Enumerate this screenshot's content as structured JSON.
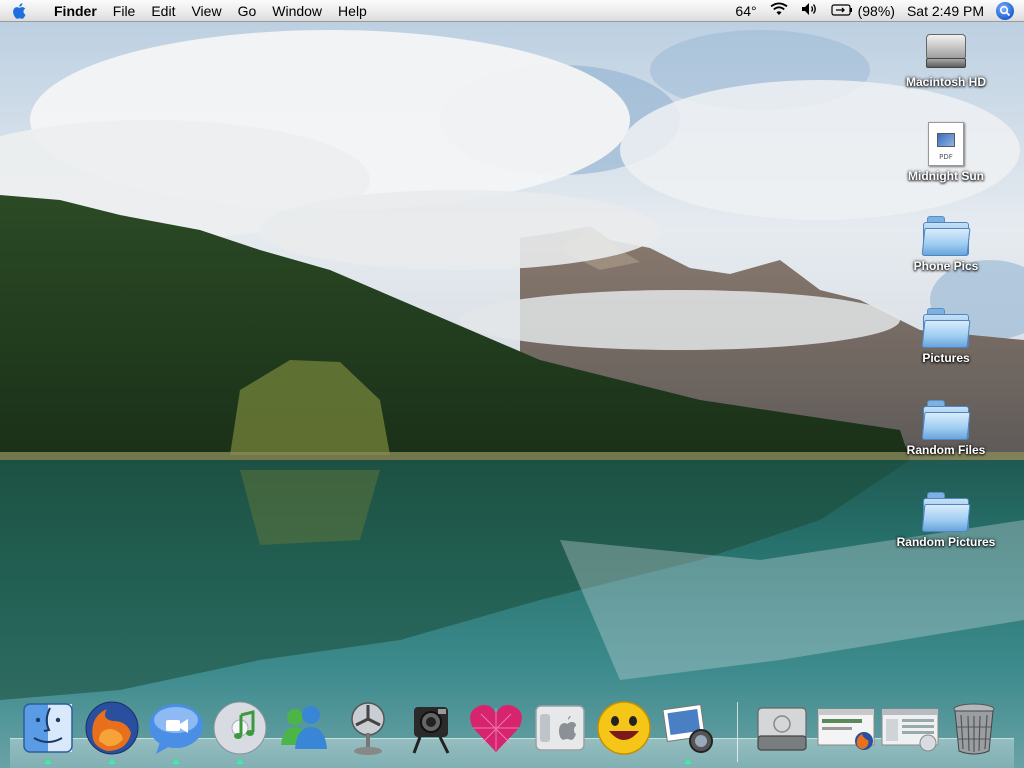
{
  "menubar": {
    "apple_icon": "apple-logo-icon",
    "items": [
      "Finder",
      "File",
      "Edit",
      "View",
      "Go",
      "Window",
      "Help"
    ],
    "temperature": "64°",
    "wifi_icon": "wifi-icon",
    "volume_icon": "volume-icon",
    "battery_icon": "battery-icon",
    "battery_text": "(98%)",
    "clock": "Sat 2:49 PM",
    "spotlight_icon": "spotlight-search-icon"
  },
  "desktop": {
    "icons": [
      {
        "label": "Macintosh HD",
        "icon": "hard-drive-icon"
      },
      {
        "label": "Midnight Sun",
        "icon": "pdf-file-icon",
        "badge": "PDF"
      },
      {
        "label": "Phone Pics",
        "icon": "folder-icon"
      },
      {
        "label": "Pictures",
        "icon": "folder-icon"
      },
      {
        "label": "Random Files",
        "icon": "folder-icon"
      },
      {
        "label": "Random Pictures",
        "icon": "folder-icon"
      }
    ]
  },
  "dock": {
    "apps": [
      {
        "name": "Finder",
        "icon": "finder-icon",
        "running": true
      },
      {
        "name": "Firefox",
        "icon": "firefox-icon",
        "running": true
      },
      {
        "name": "iChat",
        "icon": "ichat-icon",
        "running": true
      },
      {
        "name": "iTunes",
        "icon": "itunes-icon",
        "running": true
      },
      {
        "name": "MSN Messenger",
        "icon": "msn-messenger-icon",
        "running": false
      },
      {
        "name": "Fan",
        "icon": "fan-icon",
        "running": false
      },
      {
        "name": "Camera Robot",
        "icon": "camera-robot-icon",
        "running": false
      },
      {
        "name": "Heart",
        "icon": "heart-icon",
        "running": false
      },
      {
        "name": "Switch",
        "icon": "apple-switch-icon",
        "running": false
      },
      {
        "name": "Yahoo Messenger",
        "icon": "yahoo-messenger-icon",
        "running": false
      },
      {
        "name": "iPhoto",
        "icon": "iphoto-icon",
        "running": true
      }
    ],
    "docs": [
      {
        "name": "Macintosh HD",
        "icon": "dock-hard-drive-icon"
      },
      {
        "name": "Firefox Window",
        "icon": "firefox-window-icon"
      },
      {
        "name": "iTunes Window",
        "icon": "itunes-window-icon"
      },
      {
        "name": "Trash",
        "icon": "trash-icon"
      }
    ]
  },
  "colors": {
    "menubar_bg": "#ececec",
    "folder_blue": "#8fc0ec",
    "lake_teal": "#2f6f70",
    "running_indicator": "#3cf0a0"
  }
}
